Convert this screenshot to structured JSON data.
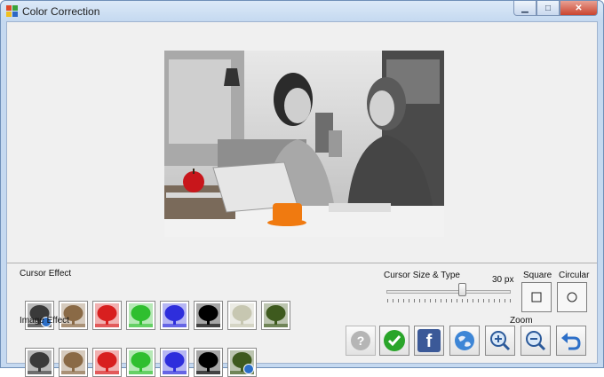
{
  "window": {
    "title": "Color Correction",
    "min_glyph": "▁",
    "max_glyph": "□",
    "close_glyph": "✕"
  },
  "cursor_effect": {
    "label": "Cursor Effect",
    "items": [
      {
        "name": "grayscale",
        "tint": "#3a3a3a",
        "selected": true
      },
      {
        "name": "sepia",
        "tint": "#8a6a46",
        "selected": false
      },
      {
        "name": "red",
        "tint": "#d81f1f",
        "selected": false
      },
      {
        "name": "green",
        "tint": "#2fbf2f",
        "selected": false
      },
      {
        "name": "blue",
        "tint": "#2e2edc",
        "selected": false
      },
      {
        "name": "black-and-white",
        "tint": "#000000",
        "selected": false
      },
      {
        "name": "faded",
        "tint": "#c7c7b1",
        "selected": false
      },
      {
        "name": "original",
        "tint": "#3e5a1e",
        "selected": false
      }
    ]
  },
  "image_effect": {
    "label": "Image Effect",
    "items": [
      {
        "name": "grayscale",
        "tint": "#3a3a3a",
        "selected": false
      },
      {
        "name": "sepia",
        "tint": "#8a6a46",
        "selected": false
      },
      {
        "name": "red",
        "tint": "#d81f1f",
        "selected": false
      },
      {
        "name": "green",
        "tint": "#2fbf2f",
        "selected": false
      },
      {
        "name": "blue",
        "tint": "#2e2edc",
        "selected": false
      },
      {
        "name": "black-and-white",
        "tint": "#000000",
        "selected": false
      },
      {
        "name": "original",
        "tint": "#3e5a1e",
        "selected": true
      }
    ]
  },
  "cursor": {
    "label": "Cursor Size & Type",
    "size_text": "30 px",
    "slider_fraction": 0.6,
    "square_label": "Square",
    "circular_label": "Circular"
  },
  "zoom": {
    "label": "Zoom"
  },
  "toolbar": {
    "help_icon": "help-icon",
    "apply_icon": "checkmark-icon",
    "facebook_letter": "f",
    "globe_icon": "globe-icon",
    "zoom_in_icon": "zoom-in-icon",
    "zoom_out_icon": "zoom-out-icon",
    "undo_icon": "undo-icon"
  },
  "colors": {
    "accent": "#2c6fc8",
    "facebook": "#3b5998",
    "apply_green": "#2aa52a",
    "apple_red": "#c8161b",
    "cup_orange": "#f07a10"
  }
}
